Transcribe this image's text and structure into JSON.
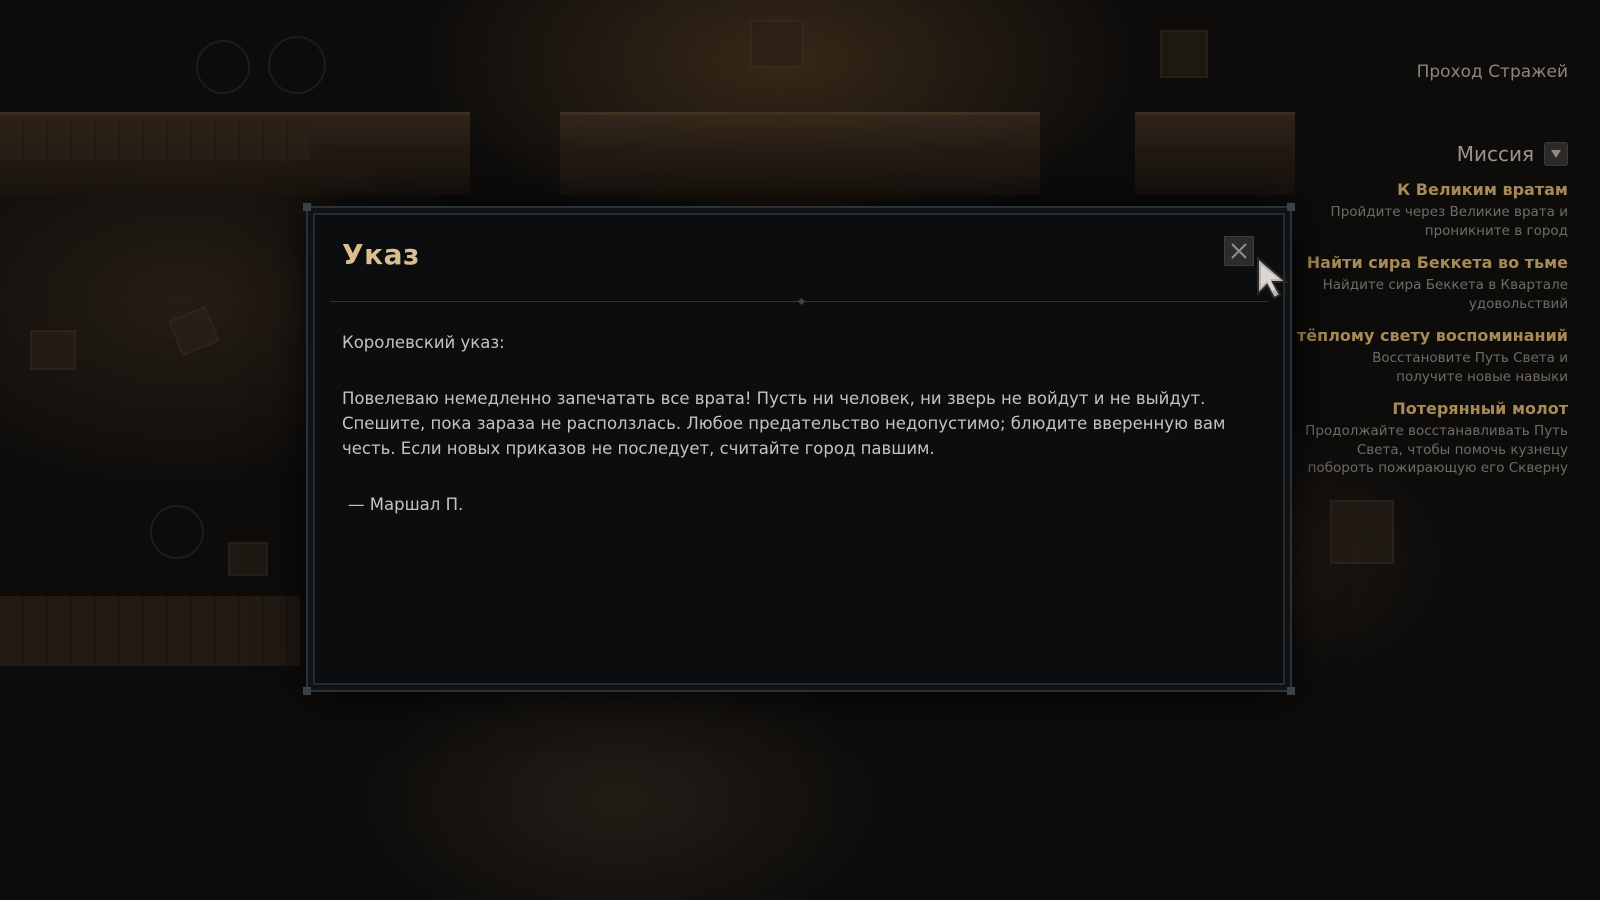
{
  "hud": {
    "location": "Проход Стражей"
  },
  "mission": {
    "title": "Миссия",
    "dropdown_icon": "chevron-down-icon",
    "quests": [
      {
        "title": "К Великим вратам",
        "description": "Пройдите через Великие врата и проникните в город"
      },
      {
        "title": "Найти сира Беккета во тьме",
        "description": "Найдите сира Беккета в Квартале удовольствий"
      },
      {
        "title": "К тёплому свету воспоминаний",
        "description": "Восстановите Путь Света и получите новые навыки"
      },
      {
        "title": "Потерянный молот",
        "description": "Продолжайте восстанавливать Путь Света, чтобы помочь кузнецу побороть пожирающую его Скверну"
      }
    ]
  },
  "dialog": {
    "title": "Указ",
    "close_icon": "close-icon",
    "greeting": "Королевский указ:",
    "message": "Повелеваю немедленно запечатать все врата! Пусть ни человек, ни зверь не войдут и не выйдут. Спешите, пока зараза не расползлась. Любое предательство недопустимо; блюдите вверенную вам честь. Если новых приказов не последует, считайте город павшим.",
    "signature": "— Маршал П."
  },
  "colors": {
    "title_gold": "#d9bf8f",
    "quest_gold": "#a88a57",
    "body_text": "#c8c3ba",
    "dialog_bg": "#0c0d0f"
  }
}
